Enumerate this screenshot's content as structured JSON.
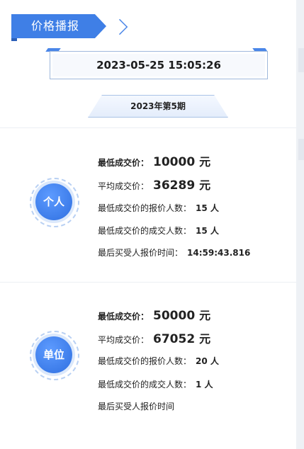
{
  "header": {
    "title": "价格播报"
  },
  "datetime": "2023-05-25 15:05:26",
  "period": "2023年第5期",
  "personal": {
    "badge": "个人",
    "min_price_label": "最低成交价：",
    "min_price": "10000",
    "min_price_unit": "元",
    "avg_price_label": "平均成交价：",
    "avg_price": "36289",
    "avg_price_unit": "元",
    "min_bidders_label": "最低成交价的报价人数：",
    "min_bidders": "15 人",
    "min_deals_label": "最低成交价的成交人数：",
    "min_deals": "15 人",
    "last_time_label": "最后买受人报价时间：",
    "last_time": "14:59:43.816"
  },
  "company": {
    "badge": "单位",
    "min_price_label": "最低成交价：",
    "min_price": "50000",
    "min_price_unit": "元",
    "avg_price_label": "平均成交价：",
    "avg_price": "67052",
    "avg_price_unit": "元",
    "min_bidders_label": "最低成交价的报价人数：",
    "min_bidders": "20 人",
    "min_deals_label": "最低成交价的成交人数：",
    "min_deals": "1 人",
    "last_time_label": "最后买受人报价时间"
  }
}
